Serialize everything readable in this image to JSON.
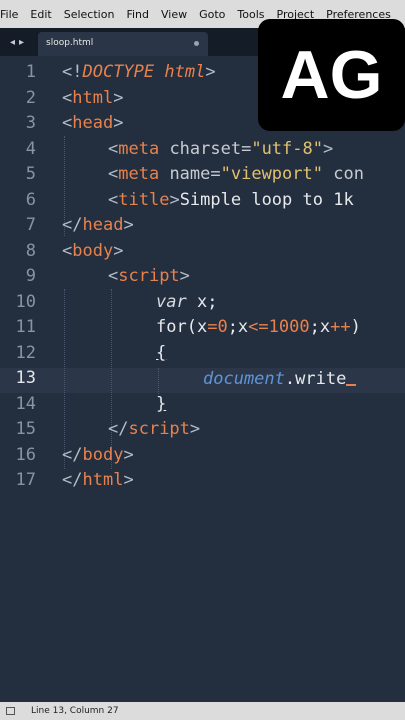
{
  "menu": [
    "File",
    "Edit",
    "Selection",
    "Find",
    "View",
    "Goto",
    "Tools",
    "Project",
    "Preferences"
  ],
  "tabbar": {
    "nav_left": "◂",
    "nav_right": "▸"
  },
  "tab": {
    "name": "sloop.html"
  },
  "line_numbers": [
    "1",
    "2",
    "3",
    "4",
    "5",
    "6",
    "7",
    "8",
    "9",
    "10",
    "11",
    "12",
    "13",
    "14",
    "15",
    "16",
    "17"
  ],
  "active_line": 13,
  "code": {
    "l1": {
      "open": "<!",
      "kw": "DOCTYPE html",
      "close": ">"
    },
    "l2": {
      "open": "<",
      "tag": "html",
      "close": ">"
    },
    "l3": {
      "open": "<",
      "tag": "head",
      "close": ">"
    },
    "l4": {
      "open": "<",
      "tag": "meta",
      "attr": " charset=",
      "val": "\"utf-8\"",
      "close": ">"
    },
    "l5": {
      "open": "<",
      "tag": "meta",
      "attr": " name=",
      "val": "\"viewport\"",
      "rest": " con"
    },
    "l6": {
      "open": "<",
      "tag": "title",
      "close": ">",
      "text": "Simple loop to 1k"
    },
    "l7": {
      "open": "</",
      "tag": "head",
      "close": ">"
    },
    "l8": {
      "open": "<",
      "tag": "body",
      "close": ">"
    },
    "l9": {
      "open": "<",
      "tag": "script",
      "close": ">"
    },
    "l10": {
      "kw": "var",
      "rest": " x;"
    },
    "l11": {
      "fn": "for(x",
      "eq1": "=",
      "n1": "0",
      "mid": ";x",
      "lte": "<=",
      "n2": "1000",
      "semi": ";x",
      "inc": "++",
      "end": ")"
    },
    "l12": {
      "brace": "{"
    },
    "l13": {
      "obj": "document",
      "rest": ".write"
    },
    "l14": {
      "brace": "}"
    },
    "l15": {
      "open": "</",
      "tag": "script",
      "close": ">"
    },
    "l16": {
      "open": "</",
      "tag": "body",
      "close": ">"
    },
    "l17": {
      "open": "</",
      "tag": "html",
      "close": ">"
    }
  },
  "logo": {
    "text": "AG"
  },
  "status": {
    "position": "Line 13, Column 27"
  },
  "colors": {
    "background": "#232e3f",
    "tag": "#e8824d",
    "string": "#e1c16e",
    "object": "#5f94d6"
  }
}
